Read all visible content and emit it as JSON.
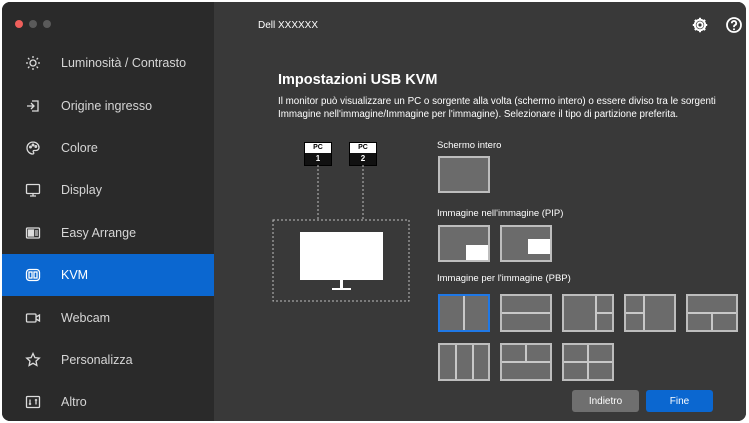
{
  "app": {
    "model": "Dell XXXXXX",
    "icons": {
      "settings": "gear-icon",
      "help": "help-circle-icon"
    }
  },
  "colors": {
    "accent": "#0b67d0",
    "sidebar_bg": "#2a2a2a",
    "main_bg": "#393939",
    "selected_border": "#1f78e6"
  },
  "sidebar": {
    "items": [
      {
        "label": "Luminosità / Contrasto",
        "icon": "brightness-icon",
        "active": false
      },
      {
        "label": "Origine ingresso",
        "icon": "input-source-icon",
        "active": false
      },
      {
        "label": "Colore",
        "icon": "color-palette-icon",
        "active": false
      },
      {
        "label": "Display",
        "icon": "display-icon",
        "active": false
      },
      {
        "label": "Easy Arrange",
        "icon": "easy-arrange-icon",
        "active": false
      },
      {
        "label": "KVM",
        "icon": "kvm-icon",
        "active": true
      },
      {
        "label": "Webcam",
        "icon": "webcam-icon",
        "active": false
      },
      {
        "label": "Personalizza",
        "icon": "star-icon",
        "active": false
      },
      {
        "label": "Altro",
        "icon": "other-icon",
        "active": false
      }
    ]
  },
  "main": {
    "title": "Impostazioni USB KVM",
    "description": "Il monitor può visualizzare un PC o sorgente alla volta (schermo intero) o essere diviso tra le sorgenti Immagine nell'immagine/Immagine per l'immagine). Selezionare il tipo di partizione preferita.",
    "diagram": {
      "pc1_top": "PC",
      "pc1_num": "1",
      "pc2_top": "PC",
      "pc2_num": "2"
    },
    "sections": {
      "fullscreen": "Schermo intero",
      "pip": "Immagine nell'immagine (PIP)",
      "pbp": "Immagine per l'immagine (PBP)"
    },
    "pbp_selected_index": 0
  },
  "buttons": {
    "back": "Indietro",
    "finish": "Fine"
  }
}
